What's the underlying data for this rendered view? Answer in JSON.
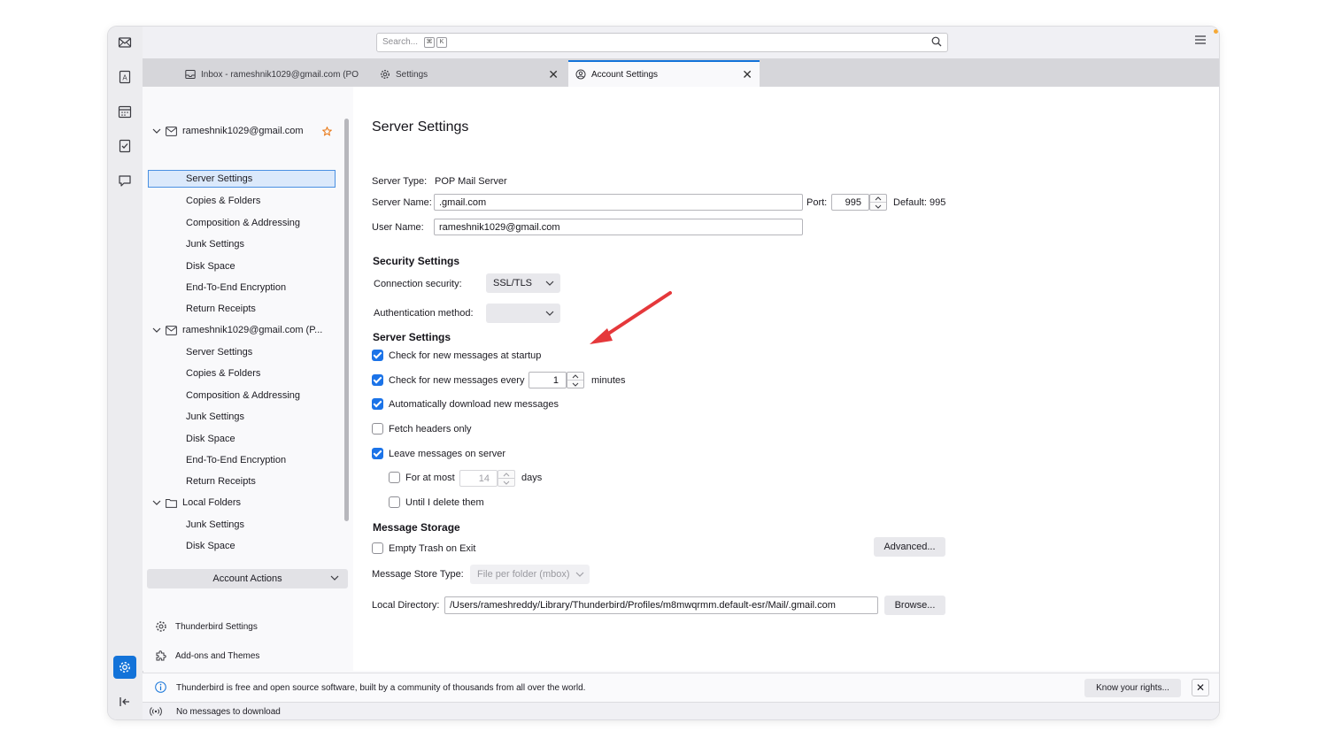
{
  "toolbar": {
    "search_placeholder": "Search...",
    "shortcut_keys": [
      "⌘",
      "K"
    ]
  },
  "tabs": [
    {
      "label": "Inbox - rameshnik1029@gmail.com (PO",
      "icon": "inbox-icon",
      "active": false
    },
    {
      "label": "Settings",
      "icon": "gear-icon",
      "active": false
    },
    {
      "label": "Account Settings",
      "icon": "account-settings-icon",
      "active": true
    }
  ],
  "sidebar": {
    "accounts": [
      {
        "name": "rameshnik1029@gmail.com",
        "items": [
          "Server Settings",
          "Copies & Folders",
          "Composition & Addressing",
          "Junk Settings",
          "Disk Space",
          "End-To-End Encryption",
          "Return Receipts"
        ]
      },
      {
        "name": "rameshnik1029@gmail.com (P...",
        "items": [
          "Server Settings",
          "Copies & Folders",
          "Composition & Addressing",
          "Junk Settings",
          "Disk Space",
          "End-To-End Encryption",
          "Return Receipts"
        ]
      },
      {
        "name": "Local Folders",
        "items": [
          "Junk Settings",
          "Disk Space"
        ]
      }
    ],
    "account_actions": "Account Actions",
    "thunderbird_settings": "Thunderbird Settings",
    "addons_themes": "Add-ons and Themes"
  },
  "content": {
    "title": "Server Settings",
    "server_type_label": "Server Type:",
    "server_type_value": "POP Mail Server",
    "server_name_label": "Server Name:",
    "server_name_value": ".gmail.com",
    "port_label": "Port:",
    "port_value": "995",
    "default_label": "Default: 995",
    "user_name_label": "User Name:",
    "user_name_value": "rameshnik1029@gmail.com",
    "security_heading": "Security Settings",
    "connection_security_label": "Connection security:",
    "connection_security_value": "SSL/TLS",
    "auth_method_label": "Authentication method:",
    "auth_method_value": "",
    "server_settings_heading": "Server Settings",
    "check_startup": "Check for new messages at startup",
    "check_every": "Check for new messages every",
    "check_every_value": "1",
    "minutes": "minutes",
    "auto_download": "Automatically download new messages",
    "fetch_headers": "Fetch headers only",
    "leave_on_server": "Leave messages on server",
    "for_at_most": "For at most",
    "for_at_most_value": "14",
    "days": "days",
    "until_delete": "Until I delete them",
    "storage_heading": "Message Storage",
    "empty_trash": "Empty Trash on Exit",
    "advanced_button": "Advanced...",
    "store_type_label": "Message Store Type:",
    "store_type_value": "File per folder (mbox)",
    "local_dir_label": "Local Directory:",
    "local_dir_value": "/Users/rameshreddy/Library/Thunderbird/Profiles/m8mwqrmm.default-esr/Mail/.gmail.com",
    "browse_button": "Browse..."
  },
  "notification": {
    "text": "Thunderbird is free and open source software, built by a community of thousands from all over the world.",
    "button": "Know your rights..."
  },
  "status": {
    "text": "No messages to download"
  },
  "colors": {
    "accent": "#1373d9",
    "annotation_arrow": "#e5383b",
    "checkbox_on": "#1b73e8"
  }
}
